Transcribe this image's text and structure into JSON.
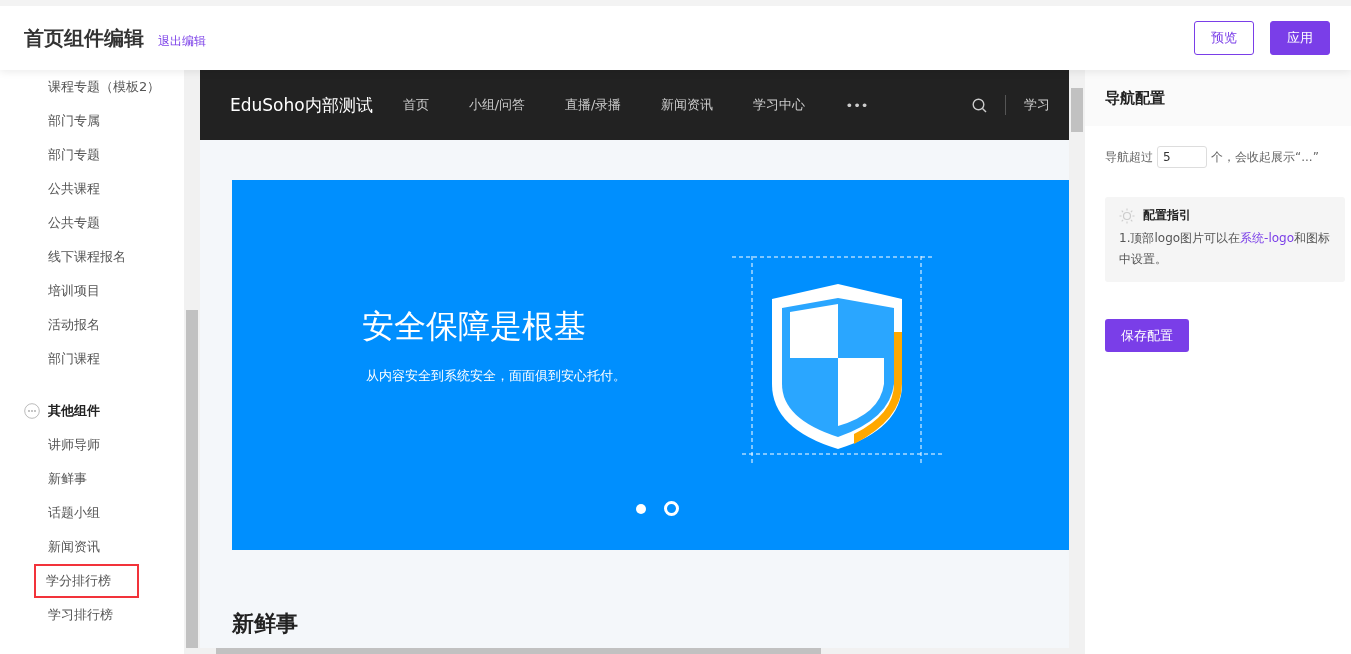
{
  "header": {
    "title": "首页组件编辑",
    "exit_link": "退出编辑",
    "buttons": [
      {
        "label": "预览",
        "kind": "outline"
      },
      {
        "label": "应用",
        "kind": "primary"
      }
    ]
  },
  "sidebar": {
    "items": [
      "课程专题（模板2）",
      "部门专属",
      "部门专题",
      "公共课程",
      "公共专题",
      "线下课程报名",
      "培训项目",
      "活动报名",
      "部门课程"
    ],
    "group": {
      "title": "其他组件",
      "items": [
        {
          "label": "讲师导师",
          "highlighted": false
        },
        {
          "label": "新鲜事",
          "highlighted": false
        },
        {
          "label": "话题小组",
          "highlighted": false
        },
        {
          "label": "新闻资讯",
          "highlighted": false
        },
        {
          "label": "学分排行榜",
          "highlighted": true
        },
        {
          "label": "学习排行榜",
          "highlighted": false
        }
      ]
    }
  },
  "preview": {
    "site_name": "EduSoho内部测试",
    "nav": [
      "首页",
      "小组/问答",
      "直播/录播",
      "新闻资讯",
      "学习中心",
      "•••"
    ],
    "nav_right": "学习",
    "banner": {
      "title": "安全保障是根基",
      "subtitle": "从内容安全到系统安全，面面俱到安心托付。",
      "dots": [
        {
          "selected": false
        },
        {
          "selected": true
        }
      ]
    },
    "section_title": "新鲜事"
  },
  "config": {
    "title": "导航配置",
    "prefix": "导航超过",
    "value": "5",
    "suffix": "个，会收起展示“...”",
    "guide": {
      "title": "配置指引",
      "text_before": "1.顶部logo图片可以在",
      "link": "系统-logo",
      "text_after": "和图标中设置。"
    },
    "save_button": "保存配置"
  }
}
